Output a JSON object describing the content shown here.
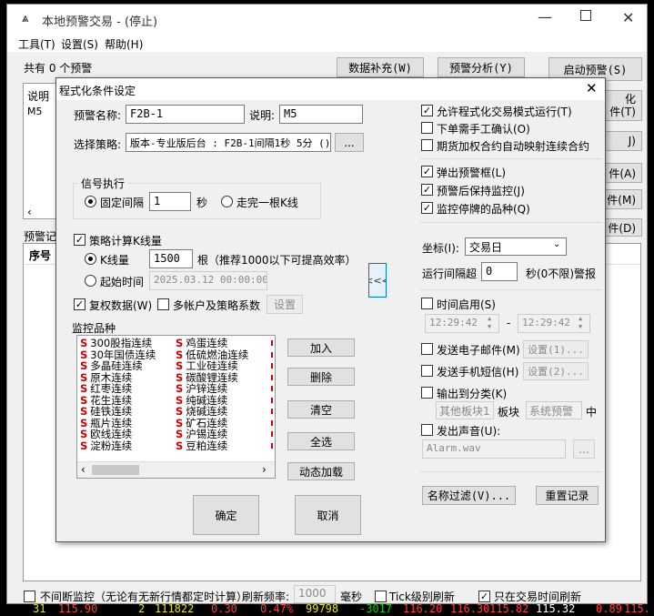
{
  "main": {
    "title": "本地预警交易 - (停止)",
    "menus": [
      "工具(T)",
      "设置(S)",
      "帮助(H)"
    ],
    "alert_count": "共有 0 个预警",
    "btn_data_fill": "数据补充(W)",
    "btn_alert_analysis": "预警分析(Y)",
    "btn_start_alert": "启动预警(S)",
    "side_btn_t": "化\n件(T)",
    "side_btn_j": "J)",
    "side_btn_a": "件(A)",
    "side_btn_m": "件(M)",
    "side_btn_d": "件(D)",
    "table_header": "说明",
    "table_row1": "M5",
    "alert_record": "预警记",
    "seq_header": "序号",
    "footer": {
      "continuous_monitor": "不间断监控（无论有无新行情都定时计算）",
      "refresh_rate_label": "刷新频率:",
      "refresh_rate": "1000",
      "refresh_unit": "毫秒",
      "tick_refresh": "Tick级别刷新",
      "trade_time_refresh": "只在交易时间刷新"
    },
    "ticker_top": [
      "31",
      "113.90",
      "2",
      "111822",
      "0.30",
      "0.47%",
      "99798",
      "-3017",
      "110.20",
      "110.30",
      "113.82",
      "113.32",
      "0.89",
      "113."
    ],
    "ticker_bottom": [
      "31",
      "115.90",
      "2",
      "111822",
      "0.30",
      "0.47%",
      "99798",
      "-3017",
      "116.20",
      "116.30",
      "115.82",
      "115.32",
      "0.89",
      "115."
    ]
  },
  "dialog": {
    "title": "程式化条件设定",
    "alert_name_label": "预警名称:",
    "alert_name": "F2B-1",
    "desc_label": "说明:",
    "desc": "M5",
    "strategy_label": "选择策略:",
    "strategy": "版本-专业版后台 : F2B-1间隔1秒 5分 ()",
    "strategy_btn": "...",
    "signal_group": "信号执行",
    "fixed_interval": "固定间隔",
    "interval_value": "1",
    "interval_unit": "秒",
    "after_kline": "走完一根K线",
    "calc_kline_count": "策略计算K线量",
    "kline_count_label": "K线量",
    "kline_count": "1500",
    "kline_hint": "根（推荐1000以下可提高效率）",
    "start_time_label": "起始时间",
    "start_time": "2025.03.12 00:00:00",
    "adjusted_data": "复权数据(W)",
    "multi_account": "多帐户及策略系数",
    "settings_btn": "设置",
    "monitor_group": "监控品种",
    "monitor_items": [
      [
        "300股指连续",
        "鸡蛋连续"
      ],
      [
        "30年国债连续",
        "低硫燃油连续"
      ],
      [
        "多晶硅连续",
        "工业硅连续"
      ],
      [
        "原木连续",
        "碳酸锂连续"
      ],
      [
        "红枣连续",
        "沪锌连续"
      ],
      [
        "花生连续",
        "纯碱连续"
      ],
      [
        "硅铁连续",
        "烧碱连续"
      ],
      [
        "瓶片连续",
        "矿石连续"
      ],
      [
        "欧线连续",
        "沪锡连续"
      ],
      [
        "淀粉连续",
        "豆粕连续"
      ]
    ],
    "item_prefix": "S",
    "btn_add": "加入",
    "btn_delete": "删除",
    "btn_clear": "清空",
    "btn_select_all": "全选",
    "btn_dynamic_load": "动态加载",
    "btn_ok": "确定",
    "btn_cancel": "取消",
    "btn_collapse": "<<<",
    "allow_program_trade": "允许程式化交易模式运行(T)",
    "manual_confirm": "下单需手工确认(O)",
    "futures_rollover": "期货加权合约自动映射连续合约",
    "popup_alert": "弹出预警框(L)",
    "keep_monitoring": "预警后保持监控(J)",
    "monitor_suspended": "监控停牌的品种(Q)",
    "coord_label": "坐标(I):",
    "coord_value": "交易日",
    "run_interval_label": "运行间隔超",
    "run_interval": "0",
    "run_interval_hint": "秒(0不限)警报",
    "time_enable": "时间启用(S)",
    "time_from": "12:29:42",
    "time_sep": "-",
    "time_to": "12:29:42",
    "send_email": "发送电子邮件(M)",
    "email_settings": "设置(1)...",
    "send_sms": "发送手机短信(H)",
    "sms_settings": "设置(2)...",
    "output_category": "输出到分类(K)",
    "other_board": "其他板块1",
    "board_label": "板块",
    "system_alert": "系统预警",
    "middle_label": "中",
    "play_sound": "发出声音(U):",
    "sound_file": "Alarm.wav",
    "sound_btn": "...",
    "name_filter": "名称过滤(V)...",
    "reset_record": "重置记录"
  },
  "colors": {
    "accent": "#0078d7",
    "item_prefix": "#d40000",
    "ticker_red": "#ff3b3b",
    "ticker_green": "#00d000",
    "ticker_yellow": "#e6e600"
  }
}
